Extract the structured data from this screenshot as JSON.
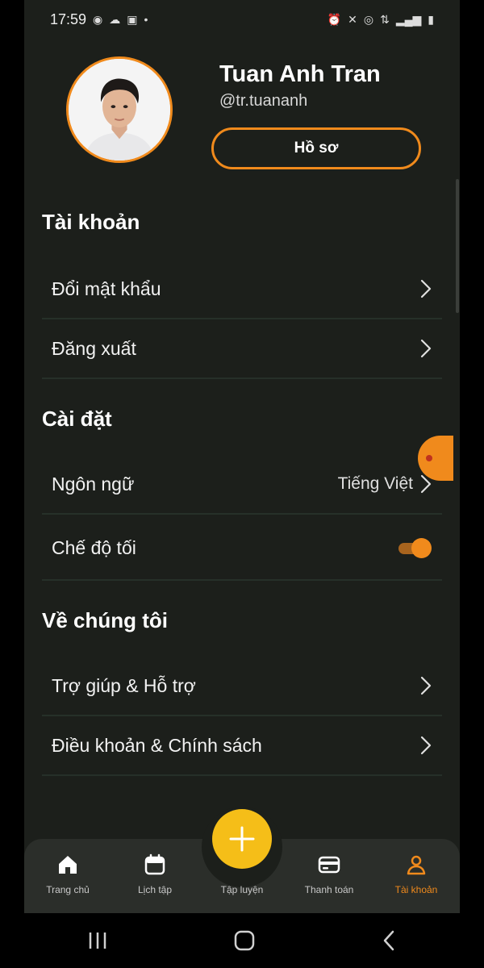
{
  "status_bar": {
    "time": "17:59",
    "left_icons": [
      "messenger-icon",
      "cloud-icon",
      "bag-icon",
      "dot-icon"
    ],
    "right_icons": [
      "alarm-icon",
      "mute-icon",
      "hotspot-icon",
      "data-icon",
      "network-icon",
      "signal-icon",
      "battery-icon"
    ]
  },
  "profile": {
    "name": "Tuan Anh Tran",
    "handle": "@tr.tuananh",
    "profile_button": "Hồ sơ"
  },
  "sections": {
    "account": {
      "title": "Tài khoản",
      "items": [
        {
          "label": "Đổi mật khẩu"
        },
        {
          "label": "Đăng xuất"
        }
      ]
    },
    "settings": {
      "title": "Cài đặt",
      "language": {
        "label": "Ngôn ngữ",
        "value": "Tiếng Việt"
      },
      "dark_mode": {
        "label": "Chế độ tối",
        "enabled": true
      }
    },
    "about": {
      "title": "Về chúng tôi",
      "items": [
        {
          "label": "Trợ giúp & Hỗ trợ"
        },
        {
          "label": "Điều khoản & Chính sách"
        }
      ]
    }
  },
  "bottom_nav": {
    "items": [
      {
        "label": "Trang chủ",
        "icon": "home-icon",
        "active": false
      },
      {
        "label": "Lịch tập",
        "icon": "calendar-icon",
        "active": false
      },
      {
        "label": "Tập luyện",
        "icon": "plus-icon",
        "active": false
      },
      {
        "label": "Thanh toán",
        "icon": "card-icon",
        "active": false
      },
      {
        "label": "Tài khoản",
        "icon": "user-icon",
        "active": true
      }
    ]
  },
  "colors": {
    "accent": "#f08a1c",
    "fab": "#f5be18",
    "background": "#1c1f1b",
    "nav_background": "#2b2e2a"
  }
}
